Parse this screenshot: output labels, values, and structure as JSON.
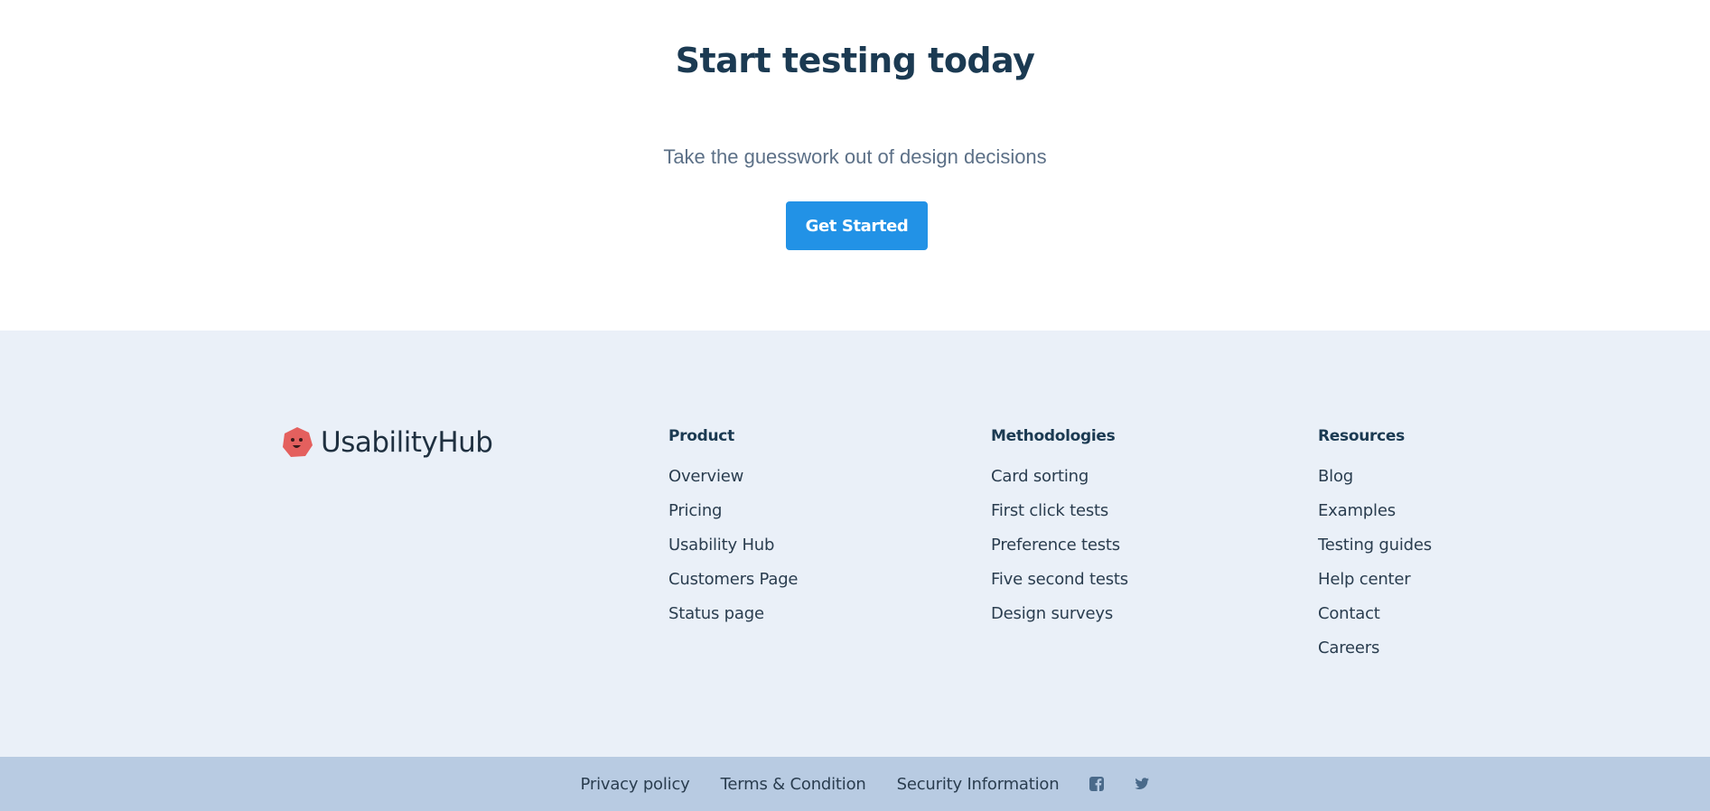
{
  "cta": {
    "title": "Start testing today",
    "subtitle": "Take the guesswork out of design decisions",
    "button_label": "Get Started"
  },
  "footer": {
    "logo_text": "UsabilityHub",
    "columns": [
      {
        "heading": "Product",
        "links": [
          "Overview",
          "Pricing",
          "Usability Hub",
          "Customers Page",
          "Status page"
        ]
      },
      {
        "heading": "Methodologies",
        "links": [
          "Card sorting",
          "First click tests",
          "Preference tests",
          "Five second tests",
          "Design surveys"
        ]
      },
      {
        "heading": "Resources",
        "links": [
          "Blog",
          "Examples",
          "Testing guides",
          "Help center",
          "Contact",
          "Careers"
        ]
      }
    ]
  },
  "bottom_bar": {
    "links": [
      "Privacy policy",
      "Terms & Condition",
      "Security Information"
    ],
    "social_icons": [
      "facebook-icon",
      "twitter-icon"
    ]
  },
  "colors": {
    "accent": "#2292e6",
    "heading": "#1b3a52",
    "footer_bg": "#eaf0f8",
    "bottom_bar_bg": "#b8cbe2",
    "logo_red": "#e4605e"
  }
}
